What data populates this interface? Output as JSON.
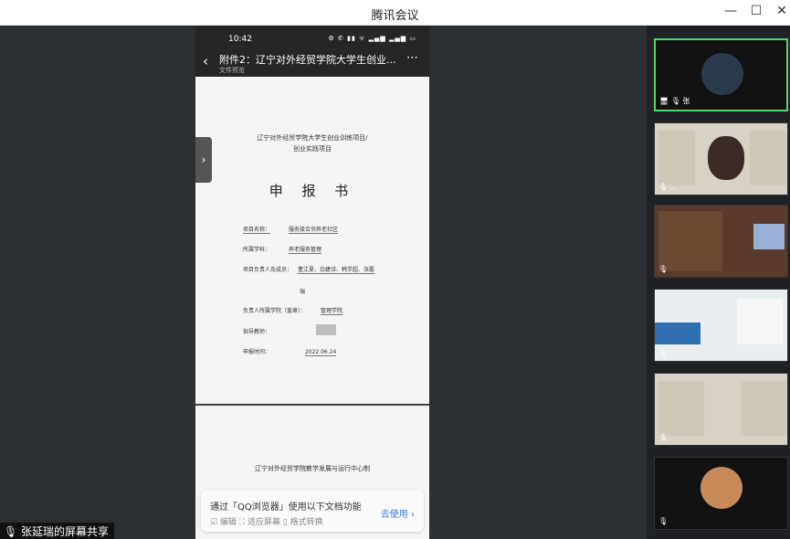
{
  "window": {
    "title": "腾讯会议",
    "minimize": "—",
    "maximize": "☐",
    "close": "✕"
  },
  "phone": {
    "status_time": "10:42",
    "status_icons": "⚙ ✆ ▮▮ ᯤ ▂▄▆ ▂▄▆ ▭",
    "doc_title": "附件2：辽宁对外经贸学院大学生创业...",
    "doc_subtitle": "文件预览",
    "back_icon": "‹",
    "more_icon": "⋯",
    "side_tab_icon": "›"
  },
  "doc": {
    "heading_line1": "辽宁对外经贸学院大学生创业训练项目/",
    "heading_line2": "创业实践项目",
    "big_title": "申 报 书",
    "fields": {
      "project_name_label": "项目名称：",
      "project_name_value": "服务接合邻养老社区",
      "category_label": "所属学科：",
      "category_value": "养老服务管理",
      "members_label": "项目负责人及成员：",
      "members_value": "董江夏、白婕诗、韩学超、张磊",
      "members_cont": "瑞",
      "college_label": "负责人所属学院（盖章）：",
      "college_value": "管理学院",
      "advisor_label": "指导教师：",
      "date_label": "申报时间：",
      "date_value": "2022.06.24"
    },
    "page2_heading": "辽宁对外经贸学院教学发展与运行中心制"
  },
  "banner": {
    "text": "通过「QQ浏览器」使用以下文档功能",
    "options": "☑ 编辑   ⛶ 适应屏幕   ▯ 格式转换",
    "button": "去使用 ›"
  },
  "share_label": "🎙 张延瑞的屏幕共享",
  "participants": [
    {
      "name": "🖥 🎙 张"
    },
    {
      "name": "🎙 ..."
    },
    {
      "name": "🎙"
    },
    {
      "name": "🎙"
    },
    {
      "name": "🎙"
    },
    {
      "name": "🎙"
    }
  ],
  "colors": {
    "stage_bg": "#2c2f33",
    "sidebar_bg": "#1f2124",
    "active_border": "#4cd964",
    "link_blue": "#3a7bd5"
  }
}
